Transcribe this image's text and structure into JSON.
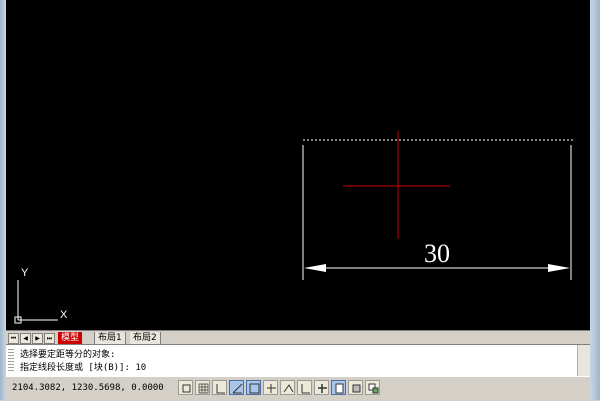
{
  "layout_tabs": {
    "model": "模型",
    "layout1": "布局1",
    "layout2": "布局2"
  },
  "command": {
    "history": "选择要定距等分的对象:",
    "current": "指定线段长度或 [块(B)]: 10"
  },
  "status": {
    "coordinates": "2104.3082, 1230.5698, 0.0000"
  },
  "drawing": {
    "dimension_text": "30",
    "ucs_x_label": "X",
    "ucs_y_label": "Y",
    "crosshair_color": "#cc0000",
    "dimension_color": "#ffffff"
  },
  "status_toggles": [
    {
      "name": "snap-toggle",
      "active": false
    },
    {
      "name": "grid-toggle",
      "active": false
    },
    {
      "name": "ortho-toggle",
      "active": false
    },
    {
      "name": "polar-toggle",
      "active": true
    },
    {
      "name": "osnap-toggle",
      "active": true
    },
    {
      "name": "3dosnap-toggle",
      "active": false
    },
    {
      "name": "otrack-toggle",
      "active": false
    },
    {
      "name": "ducs-toggle",
      "active": false
    },
    {
      "name": "dyn-toggle",
      "active": false
    },
    {
      "name": "lineweight-toggle",
      "active": true
    },
    {
      "name": "transparency-toggle",
      "active": false
    },
    {
      "name": "quickprops-toggle",
      "active": false
    }
  ]
}
